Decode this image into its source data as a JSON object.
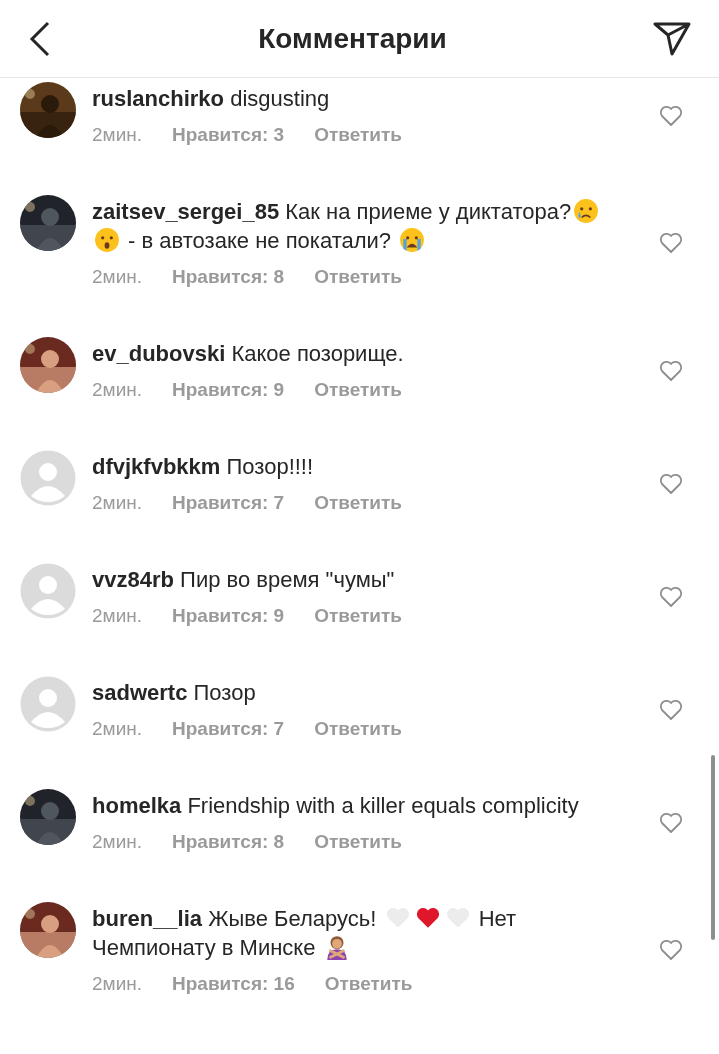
{
  "header": {
    "title": "Комментарии"
  },
  "comments": [
    {
      "avatar": {
        "kind": "picture"
      },
      "user": "ruslanchirko",
      "parts": [
        {
          "kind": "text",
          "text": "disgusting"
        }
      ],
      "time": "2мин.",
      "likes": "Нравится: 3",
      "reply": "Ответить"
    },
    {
      "avatar": {
        "kind": "picture"
      },
      "user": "zaitsev_sergei_85",
      "parts": [
        {
          "kind": "text",
          "text": "Как на приеме у диктатора?"
        },
        {
          "kind": "crying-face"
        },
        {
          "kind": "surprised-face"
        },
        {
          "kind": "text",
          "text": " - в автозаке не покатали? "
        },
        {
          "kind": "sobbing-face"
        }
      ],
      "time": "2мин.",
      "likes": "Нравится: 8",
      "reply": "Ответить"
    },
    {
      "avatar": {
        "kind": "picture"
      },
      "user": "ev_dubovski",
      "parts": [
        {
          "kind": "text",
          "text": "Какое позорище."
        }
      ],
      "time": "2мин.",
      "likes": "Нравится: 9",
      "reply": "Ответить"
    },
    {
      "avatar": {
        "kind": "default"
      },
      "user": "dfvjkfvbkkm",
      "parts": [
        {
          "kind": "text",
          "text": "Позор!!!!"
        }
      ],
      "time": "2мин.",
      "likes": "Нравится: 7",
      "reply": "Ответить"
    },
    {
      "avatar": {
        "kind": "default"
      },
      "user": "vvz84rb",
      "parts": [
        {
          "kind": "text",
          "text": "Пир во время \"чумы\""
        }
      ],
      "time": "2мин.",
      "likes": "Нравится: 9",
      "reply": "Ответить"
    },
    {
      "avatar": {
        "kind": "default"
      },
      "user": "sadwertc",
      "parts": [
        {
          "kind": "text",
          "text": "Позор"
        }
      ],
      "time": "2мин.",
      "likes": "Нравится: 7",
      "reply": "Ответить"
    },
    {
      "avatar": {
        "kind": "picture"
      },
      "user": "homelka",
      "parts": [
        {
          "kind": "text",
          "text": "Friendship with a killer equals complicity"
        }
      ],
      "time": "2мин.",
      "likes": "Нравится: 8",
      "reply": "Ответить"
    },
    {
      "avatar": {
        "kind": "picture"
      },
      "user": "buren__lia",
      "parts": [
        {
          "kind": "text",
          "text": "Жыве Беларусь! "
        },
        {
          "kind": "white-heart"
        },
        {
          "kind": "red-heart"
        },
        {
          "kind": "white-heart"
        },
        {
          "kind": "text",
          "text": " Нет Чемпионату в Минске "
        },
        {
          "kind": "gesture-no"
        }
      ],
      "time": "2мин.",
      "likes": "Нравится: 16",
      "reply": "Ответить"
    }
  ]
}
